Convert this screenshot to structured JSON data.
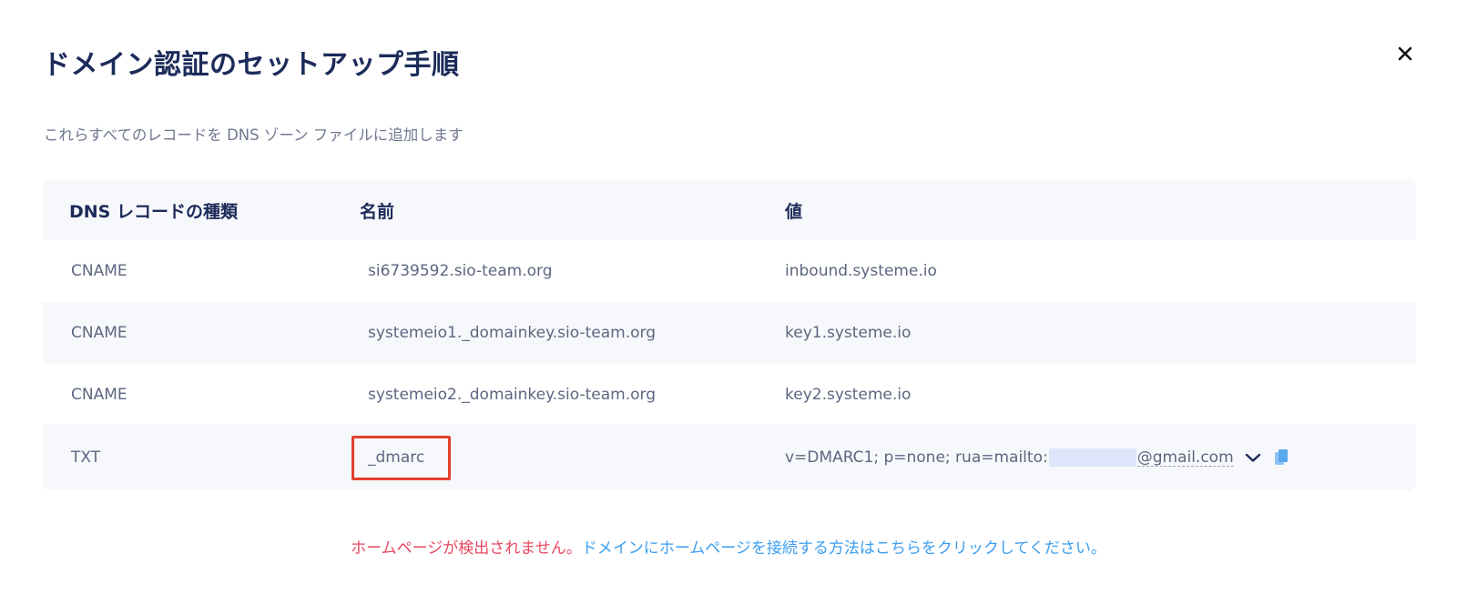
{
  "modal": {
    "title": "ドメイン認証のセットアップ手順",
    "subtitle": "これらすべてのレコードを DNS ゾーン ファイルに追加します",
    "close_icon": "close-icon"
  },
  "table": {
    "headers": [
      "DNS レコードの種類",
      "名前",
      "値"
    ],
    "rows": [
      {
        "type": "CNAME",
        "name": "si6739592.sio-team.org",
        "value": "inbound.systeme.io"
      },
      {
        "type": "CNAME",
        "name": "systemeio1._domainkey.sio-team.org",
        "value": "key1.systeme.io"
      },
      {
        "type": "CNAME",
        "name": "systemeio2._domainkey.sio-team.org",
        "value": "key2.systeme.io"
      },
      {
        "type": "TXT",
        "name": "_dmarc",
        "value_prefix": "v=DMARC1; p=none; rua=mailto:",
        "value_suffix": "@gmail.com"
      }
    ]
  },
  "footer": {
    "warning": "ホームページが検出されません。",
    "link": "ドメインにホームページを接続する方法はこちらをクリックしてください。"
  },
  "colors": {
    "title": "#1c2b5a",
    "warning": "#e8475f",
    "link": "#3c9ef0",
    "highlight": "#e2412e",
    "copy_icon": "#5aa8ec"
  }
}
